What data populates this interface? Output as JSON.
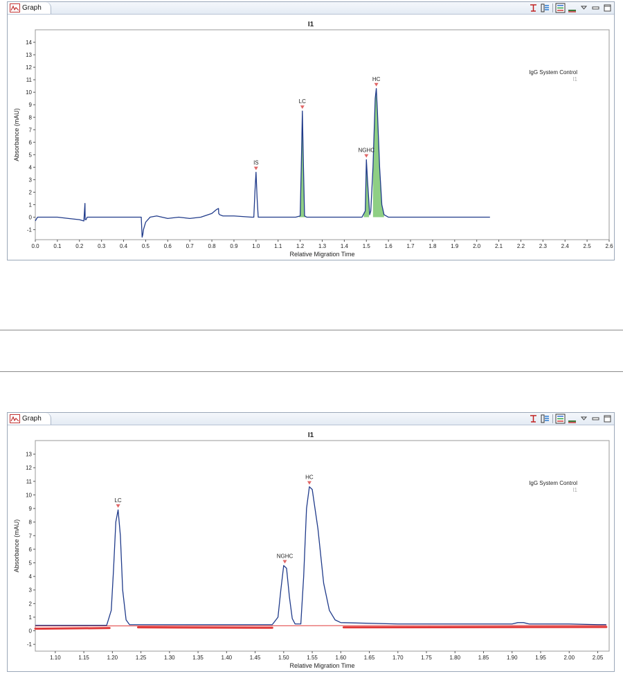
{
  "panels": [
    {
      "tab_label": "Graph",
      "toolbar_icons": [
        "pin-icon",
        "grid-settings-icon",
        "legend-icon",
        "color-bar-icon",
        "view-menu-icon",
        "minimize-icon",
        "maximize-icon"
      ]
    },
    {
      "tab_label": "Graph",
      "toolbar_icons": [
        "pin-icon",
        "grid-settings-icon",
        "legend-icon",
        "color-bar-icon",
        "view-menu-icon",
        "minimize-icon",
        "maximize-icon"
      ]
    }
  ],
  "chart_data": [
    {
      "type": "line",
      "title": "I1",
      "xlabel": "Relative Migration Time",
      "ylabel": "Absorbance (mAU)",
      "xlim": [
        0.0,
        2.6
      ],
      "ylim": [
        -1.8,
        15
      ],
      "xticks": [
        "0.0",
        "0.1",
        "0.2",
        "0.3",
        "0.4",
        "0.5",
        "0.6",
        "0.7",
        "0.8",
        "0.9",
        "1.0",
        "1.1",
        "1.2",
        "1.3",
        "1.4",
        "1.5",
        "1.6",
        "1.7",
        "1.8",
        "1.9",
        "2.0",
        "2.1",
        "2.2",
        "2.3",
        "2.4",
        "2.5",
        "2.6"
      ],
      "yticks": [
        "-1",
        "0",
        "1",
        "2",
        "3",
        "4",
        "5",
        "6",
        "7",
        "8",
        "9",
        "10",
        "11",
        "12",
        "13",
        "14"
      ],
      "legend": {
        "title": "IgG System Control",
        "entry": "I1",
        "placement": "top-right"
      },
      "series": [
        {
          "color": "#1f3a8a",
          "x": [
            0.0,
            0.01,
            0.05,
            0.1,
            0.15,
            0.2,
            0.22,
            0.225,
            0.226,
            0.23,
            0.235,
            0.26,
            0.3,
            0.35,
            0.4,
            0.45,
            0.48,
            0.484,
            0.487,
            0.49,
            0.5,
            0.52,
            0.55,
            0.6,
            0.65,
            0.7,
            0.75,
            0.8,
            0.82,
            0.83,
            0.831,
            0.835,
            0.85,
            0.9,
            0.98,
            0.99,
            0.995,
            1.0,
            1.005,
            1.01,
            1.02,
            1.1,
            1.18,
            1.2,
            1.205,
            1.21,
            1.215,
            1.22,
            1.23,
            1.3,
            1.4,
            1.48,
            1.495,
            1.5,
            1.505,
            1.515,
            1.52,
            1.53,
            1.54,
            1.545,
            1.55,
            1.56,
            1.57,
            1.58,
            1.6,
            1.7,
            1.8,
            1.9,
            2.0,
            2.06
          ],
          "y": [
            -0.3,
            0.0,
            0.0,
            0.0,
            -0.1,
            -0.2,
            -0.3,
            1.1,
            -0.2,
            -0.2,
            0.0,
            0.0,
            0.0,
            0.0,
            0.0,
            0.0,
            0.0,
            -1.6,
            -1.4,
            -1.0,
            -0.4,
            0.0,
            0.1,
            -0.1,
            0.0,
            -0.1,
            0.0,
            0.3,
            0.6,
            0.7,
            0.3,
            0.2,
            0.1,
            0.1,
            0.0,
            0.0,
            2.0,
            3.6,
            1.5,
            0.0,
            0.0,
            0.0,
            0.0,
            0.1,
            4.0,
            8.5,
            4.0,
            0.1,
            0.0,
            0.0,
            0.0,
            0.0,
            0.5,
            4.6,
            3.0,
            0.2,
            0.5,
            4.0,
            9.5,
            10.3,
            8.5,
            4.0,
            1.0,
            0.2,
            0.0,
            0.0,
            0.0,
            0.0,
            0.0,
            0.0
          ]
        }
      ],
      "peaks": [
        {
          "label": "IS",
          "x": 1.0,
          "y": 3.6,
          "fill": false
        },
        {
          "label": "LC",
          "x": 1.21,
          "y": 8.5,
          "fill": true,
          "from": 1.195,
          "to": 1.232
        },
        {
          "label": "NGHC",
          "x": 1.5,
          "y": 4.6,
          "fill": true,
          "from": 1.488,
          "to": 1.512
        },
        {
          "label": "HC",
          "x": 1.545,
          "y": 10.3,
          "fill": true,
          "from": 1.53,
          "to": 1.58
        }
      ]
    },
    {
      "type": "line",
      "title": "I1",
      "xlabel": "Relative Migration Time",
      "ylabel": "Absorbance (mAU)",
      "xlim": [
        1.065,
        2.07
      ],
      "ylim": [
        -1.5,
        14
      ],
      "xticks": [
        "1.10",
        "1.15",
        "1.20",
        "1.25",
        "1.30",
        "1.35",
        "1.40",
        "1.45",
        "1.50",
        "1.55",
        "1.60",
        "1.65",
        "1.70",
        "1.75",
        "1.80",
        "1.85",
        "1.90",
        "1.95",
        "2.00",
        "2.05"
      ],
      "yticks": [
        "-1",
        "0",
        "1",
        "2",
        "3",
        "4",
        "5",
        "6",
        "7",
        "8",
        "9",
        "10",
        "11",
        "12",
        "13"
      ],
      "legend": {
        "title": "IgG System Control",
        "entry": "I1",
        "placement": "top-right"
      },
      "series": [
        {
          "color": "#1f3a8a",
          "x": [
            1.065,
            1.1,
            1.15,
            1.19,
            1.198,
            1.202,
            1.206,
            1.21,
            1.214,
            1.218,
            1.224,
            1.23,
            1.3,
            1.4,
            1.48,
            1.49,
            1.495,
            1.5,
            1.505,
            1.51,
            1.515,
            1.52,
            1.53,
            1.535,
            1.54,
            1.545,
            1.55,
            1.56,
            1.57,
            1.58,
            1.59,
            1.6,
            1.7,
            1.8,
            1.9,
            1.91,
            1.92,
            1.93,
            1.95,
            2.0,
            2.05,
            2.065
          ],
          "y": [
            0.4,
            0.4,
            0.4,
            0.4,
            1.5,
            4.5,
            8.0,
            8.9,
            7.0,
            3.0,
            0.8,
            0.45,
            0.45,
            0.45,
            0.45,
            1.0,
            3.0,
            4.8,
            4.6,
            2.5,
            0.9,
            0.5,
            0.5,
            4.0,
            9.0,
            10.6,
            10.4,
            7.5,
            3.5,
            1.5,
            0.8,
            0.6,
            0.5,
            0.5,
            0.5,
            0.6,
            0.6,
            0.5,
            0.5,
            0.5,
            0.45,
            0.45
          ]
        }
      ],
      "baselines": [
        {
          "x": [
            1.065,
            2.065
          ],
          "y": [
            0.35,
            0.4
          ],
          "color": "#e03a3a",
          "width": 1
        },
        {
          "x": [
            1.065,
            1.195
          ],
          "y": [
            0.15,
            0.2
          ],
          "color": "#e03a3a",
          "width": 3
        },
        {
          "x": [
            1.245,
            1.48
          ],
          "y": [
            0.25,
            0.22
          ],
          "color": "#e03a3a",
          "width": 3
        },
        {
          "x": [
            1.605,
            2.065
          ],
          "y": [
            0.25,
            0.28
          ],
          "color": "#e03a3a",
          "width": 3
        }
      ],
      "peaks": [
        {
          "label": "LC",
          "x": 1.21,
          "y": 8.9
        },
        {
          "label": "NGHC",
          "x": 1.502,
          "y": 4.8
        },
        {
          "label": "HC",
          "x": 1.545,
          "y": 10.6
        }
      ]
    }
  ]
}
